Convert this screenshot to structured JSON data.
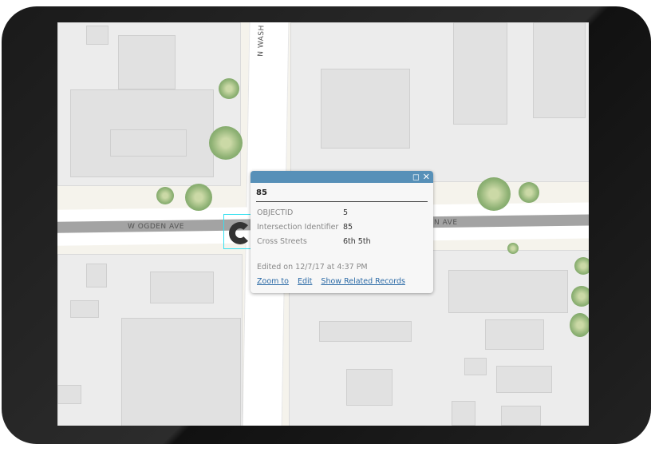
{
  "map": {
    "street_labels": {
      "ogden_west": "W OGDEN AVE",
      "ogden_east": "N AVE",
      "washington": "N WASH"
    }
  },
  "popup": {
    "title": "85",
    "header_icons": [
      "maximize-icon",
      "close-icon"
    ],
    "fields": [
      {
        "label": "OBJECTID",
        "value": "5"
      },
      {
        "label": "Intersection Identifier",
        "value": "85"
      },
      {
        "label": "Cross Streets",
        "value": "6th 5th"
      }
    ],
    "edited": "Edited on 12/7/17 at 4:37 PM",
    "actions": {
      "zoom": "Zoom to",
      "edit": "Edit",
      "related": "Show Related Records"
    }
  },
  "colors": {
    "popup_header": "#5790b8",
    "link": "#2b6aa6",
    "selection": "#35e0f0"
  }
}
